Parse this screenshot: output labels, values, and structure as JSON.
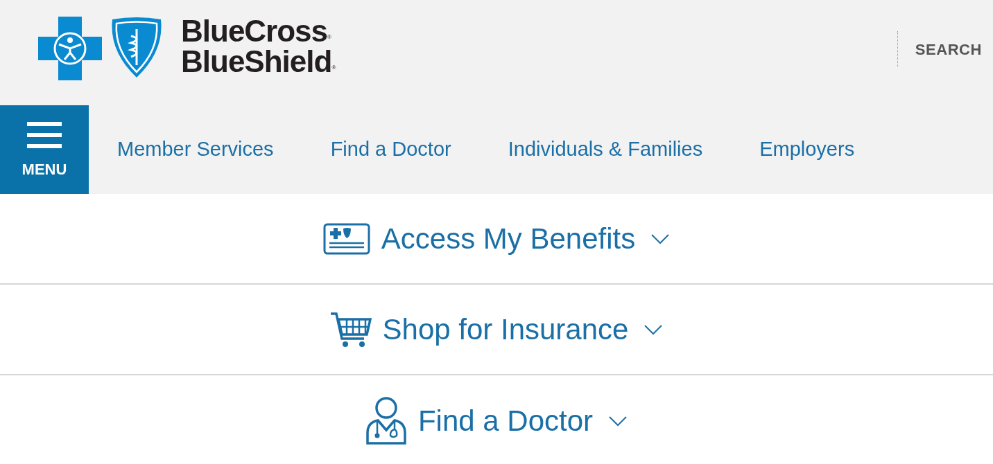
{
  "header": {
    "logo": {
      "lines": [
        "BlueCross",
        "BlueShield"
      ],
      "registered_mark": "®"
    },
    "search": "SEARCH"
  },
  "nav": {
    "menu_label": "MENU",
    "items": [
      {
        "label": "Member Services"
      },
      {
        "label": "Find a Doctor"
      },
      {
        "label": "Individuals & Families"
      },
      {
        "label": "Employers"
      }
    ]
  },
  "sections": [
    {
      "kind": "card",
      "label": "Access My Benefits",
      "expanded": false
    },
    {
      "kind": "cart",
      "label": "Shop for Insurance",
      "expanded": false
    },
    {
      "kind": "doctor",
      "label": "Find a Doctor",
      "expanded": false
    }
  ]
}
